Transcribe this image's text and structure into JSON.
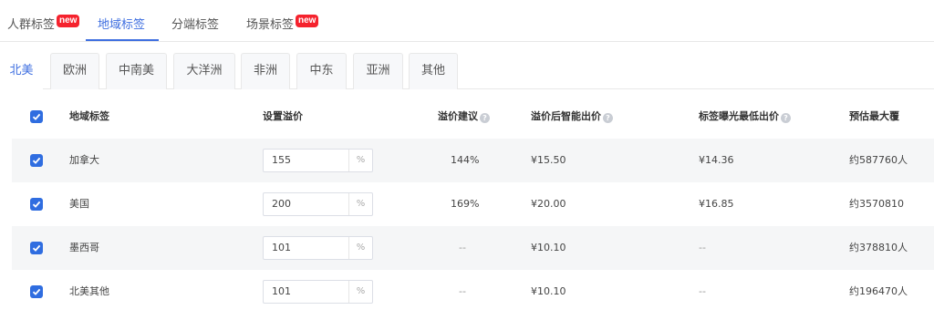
{
  "top_tabs": [
    {
      "label": "人群标签",
      "badge": "new"
    },
    {
      "label": "地域标签",
      "badge": ""
    },
    {
      "label": "分端标签",
      "badge": ""
    },
    {
      "label": "场景标签",
      "badge": "new"
    }
  ],
  "region_tabs": [
    "北美",
    "欧洲",
    "中南美",
    "大洋洲",
    "非洲",
    "中东",
    "亚洲",
    "其他"
  ],
  "table": {
    "headers": {
      "region": "地域标签",
      "bid": "设置溢价",
      "suggest": "溢价建议",
      "smart": "溢价后智能出价",
      "min": "标签曝光最低出价",
      "reach": "预估最大覆"
    },
    "rows": [
      {
        "region": "加拿大",
        "bid": "155",
        "unit": "%",
        "suggest": "144%",
        "smart": "¥15.50",
        "min": "¥14.36",
        "reach": "约587760人"
      },
      {
        "region": "美国",
        "bid": "200",
        "unit": "%",
        "suggest": "169%",
        "smart": "¥20.00",
        "min": "¥16.85",
        "reach": "约3570810"
      },
      {
        "region": "墨西哥",
        "bid": "101",
        "unit": "%",
        "suggest": "--",
        "smart": "¥10.10",
        "min": "--",
        "reach": "约378810人"
      },
      {
        "region": "北美其他",
        "bid": "101",
        "unit": "%",
        "suggest": "--",
        "smart": "¥10.10",
        "min": "--",
        "reach": "约196470人"
      }
    ]
  },
  "colors": {
    "accent": "#3f6fe0",
    "badge": "#f5222d",
    "checkbox": "#2f6de0"
  }
}
